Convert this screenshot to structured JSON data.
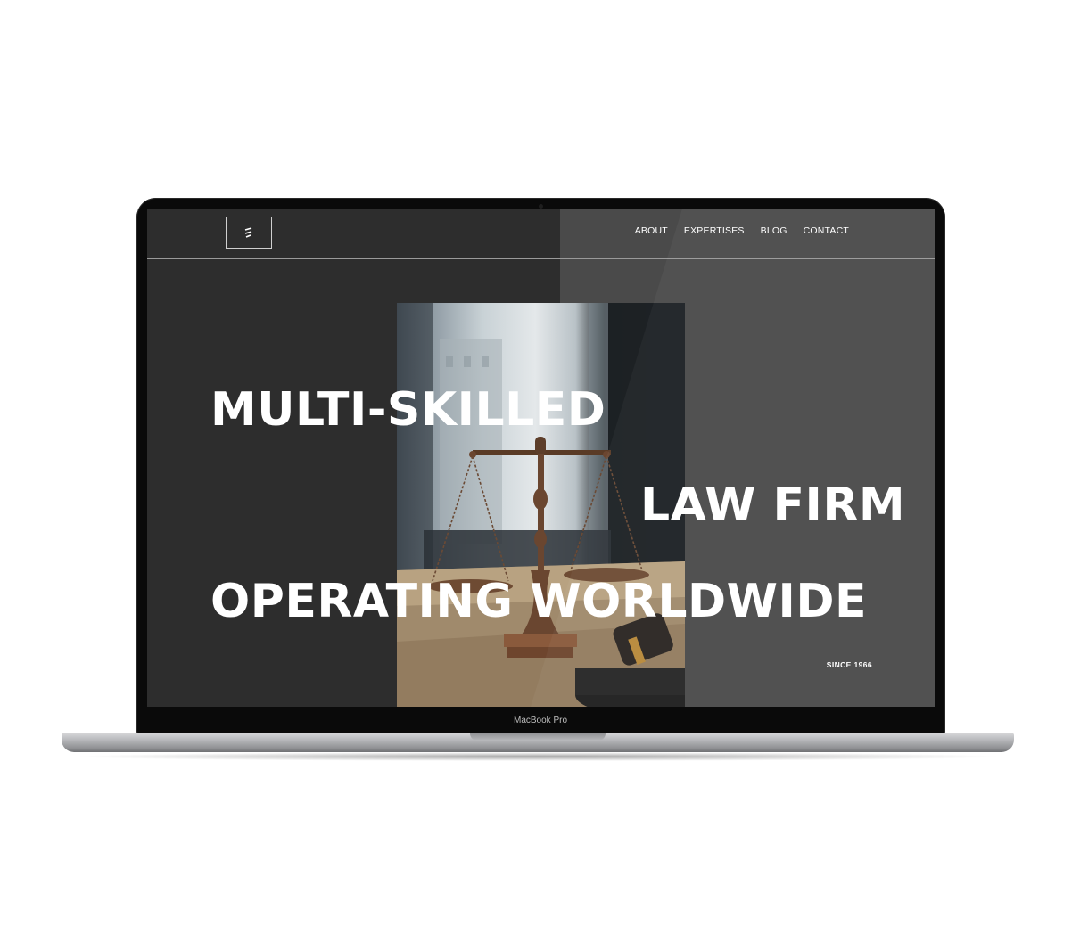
{
  "device": {
    "model_label": "MacBook Pro"
  },
  "site": {
    "logo_icon": "law-firm-logo-icon",
    "nav": [
      {
        "label": "ABOUT"
      },
      {
        "label": "EXPERTISES"
      },
      {
        "label": "BLOG"
      },
      {
        "label": "CONTACT"
      }
    ],
    "hero": {
      "line1": "MULTI-SKILLED",
      "line2": "LAW FIRM",
      "line3": "OPERATING WORLDWIDE",
      "since": "SINCE 1966",
      "photo_subject": "scales-of-justice-and-gavel"
    }
  },
  "colors": {
    "screen_dark": "#2d2d2d",
    "screen_panel": "#4a4a4a",
    "text": "#ffffff"
  }
}
